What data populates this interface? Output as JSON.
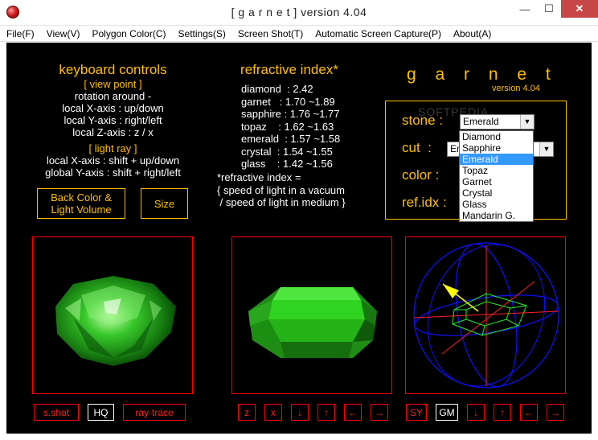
{
  "window": {
    "title": "[ g a r n e t ] version 4.04",
    "minimize": "—",
    "maximize": "☐",
    "close": "✕"
  },
  "menu": [
    "File(F)",
    "View(V)",
    "Polygon Color(C)",
    "Settings(S)",
    "Screen Shot(T)",
    "Automatic Screen Capture(P)",
    "About(A)"
  ],
  "keyboard": {
    "heading": "keyboard controls",
    "viewpoint_heading": "[ view point ]",
    "rotation": "rotation around -",
    "x_axis": "local X-axis : up/down",
    "y_axis": "local Y-axis : right/left",
    "z_axis": "local Z-axis : z / x",
    "lightray_heading": "[ light ray ]",
    "lr_x": "local X-axis : shift + up/down",
    "lr_y": "global Y-axis : shift + right/left"
  },
  "buttons": {
    "back_color": "Back Color &\nLight Volume",
    "size": "Size"
  },
  "refractive": {
    "heading": "refractive index*",
    "rows": [
      "diamond  : 2.42",
      "garnet   : 1.70 ~1.89",
      "sapphire : 1.76 ~1.77",
      "topaz    : 1.62 ~1.63",
      "emerald  : 1.57 ~1.58",
      "crystal  : 1.54 ~1.55",
      "glass    : 1.42 ~1.56"
    ],
    "note": "*refractive index =\n{ speed of light in a vacuum\n / speed of light in medium }"
  },
  "brand": {
    "name": "g a r n e t",
    "version": "version 4.04",
    "watermark": "SOFTPEDIA"
  },
  "panel": {
    "stone_label": "stone :",
    "cut_label": "cut  :",
    "color_label": "color :",
    "refidx_label": "ref.idx :",
    "stone_value": "Emerald",
    "cut_value": "Em",
    "stone_options": [
      "Diamond",
      "Sapphire",
      "Emerald",
      "Topaz",
      "Garnet",
      "Crystal",
      "Glass",
      "Mandarin G."
    ],
    "selected_index": 2
  },
  "bottom": {
    "left": [
      "s.shot",
      "HQ",
      "ray-trace"
    ],
    "middle": [
      "z",
      "x",
      "↓",
      "↑",
      "←",
      "→"
    ],
    "right": [
      "SY",
      "GM",
      "↓",
      "↑",
      "←",
      "→"
    ]
  },
  "colors": {
    "accent": "#ffbf00",
    "frame": "#ff0000",
    "gem_green": "#22c322",
    "selection": "#3399ff"
  }
}
